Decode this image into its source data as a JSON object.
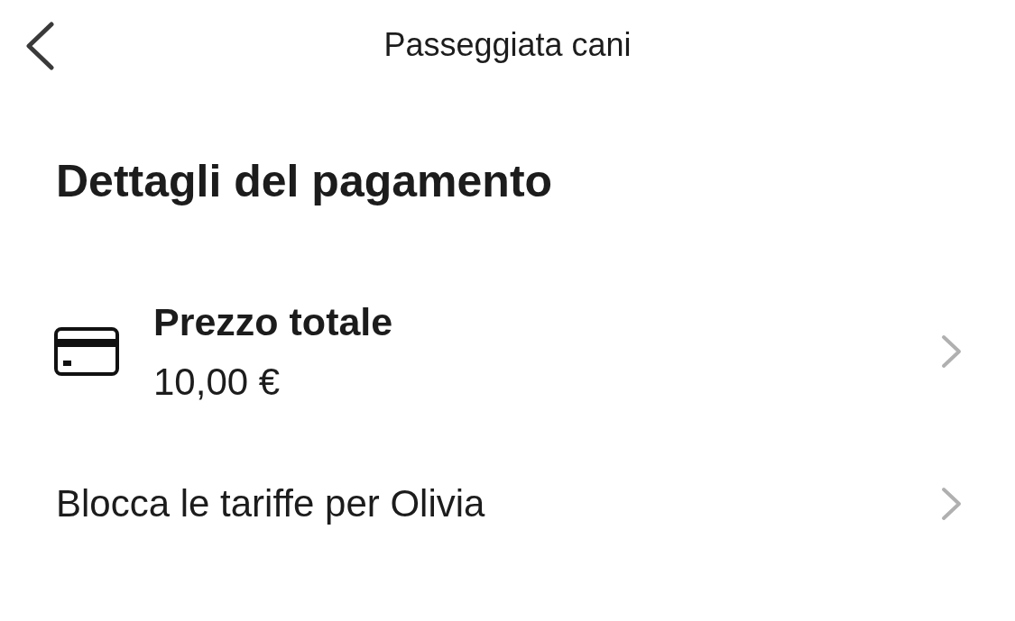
{
  "header": {
    "title": "Passeggiata cani"
  },
  "heading": "Dettagli del pagamento",
  "rows": [
    {
      "kind": "price",
      "title": "Prezzo totale",
      "value": "10,00 €"
    },
    {
      "kind": "link",
      "title": "Blocca le tariffe per Olivia"
    }
  ]
}
